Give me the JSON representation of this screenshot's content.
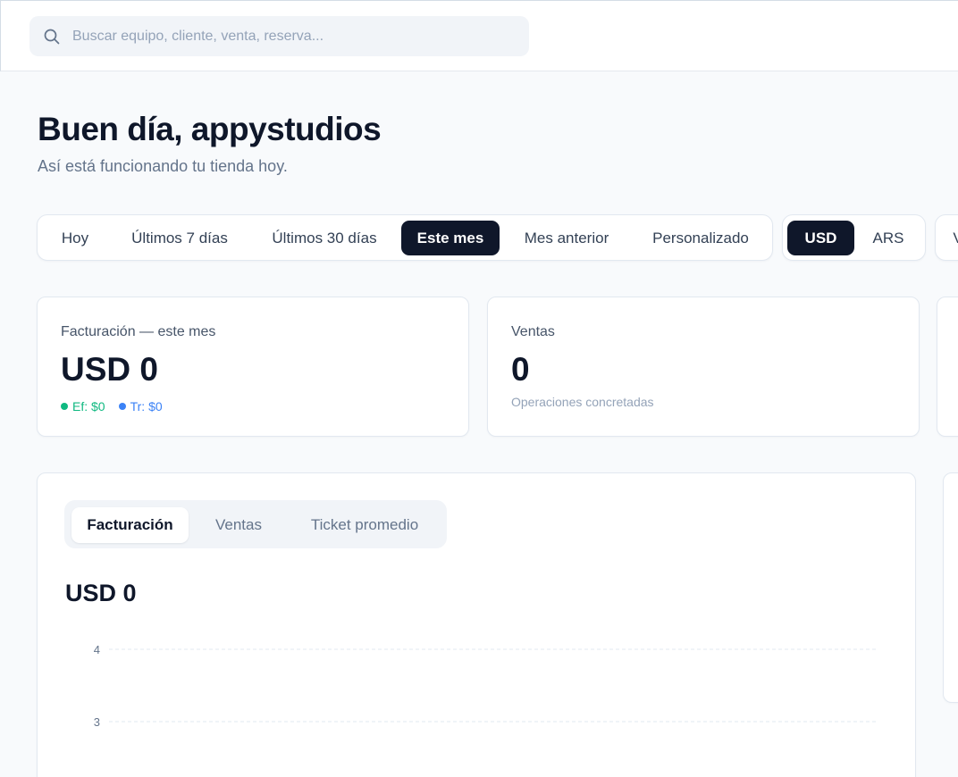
{
  "search": {
    "placeholder": "Buscar equipo, cliente, venta, reserva..."
  },
  "header": {
    "greeting": "Buen día, appystudios",
    "subtitle": "Así está funcionando tu tienda hoy."
  },
  "periods": [
    {
      "label": "Hoy",
      "active": false
    },
    {
      "label": "Últimos 7 días",
      "active": false
    },
    {
      "label": "Últimos 30 días",
      "active": false
    },
    {
      "label": "Este mes",
      "active": true
    },
    {
      "label": "Mes anterior",
      "active": false
    },
    {
      "label": "Personalizado",
      "active": false
    }
  ],
  "currencies": [
    {
      "label": "USD",
      "active": true
    },
    {
      "label": "ARS",
      "active": false
    }
  ],
  "extra_toggle_partial": "V",
  "kpis": {
    "revenue": {
      "label": "Facturación — este mes",
      "value": "USD 0",
      "cash": "Ef: $0",
      "transfer": "Tr: $0"
    },
    "sales": {
      "label": "Ventas",
      "value": "0",
      "note": "Operaciones concretadas"
    }
  },
  "chart_panel": {
    "tabs": [
      {
        "label": "Facturación",
        "active": true
      },
      {
        "label": "Ventas",
        "active": false
      },
      {
        "label": "Ticket promedio",
        "active": false
      }
    ],
    "total": "USD 0"
  },
  "chart_data": {
    "type": "line",
    "series": [],
    "yticks": [
      4,
      3
    ],
    "grid": true
  },
  "colors": {
    "accent": "#0f172a",
    "cash": "#10b981",
    "transfer": "#3b82f6",
    "background": "#f8fafc"
  }
}
